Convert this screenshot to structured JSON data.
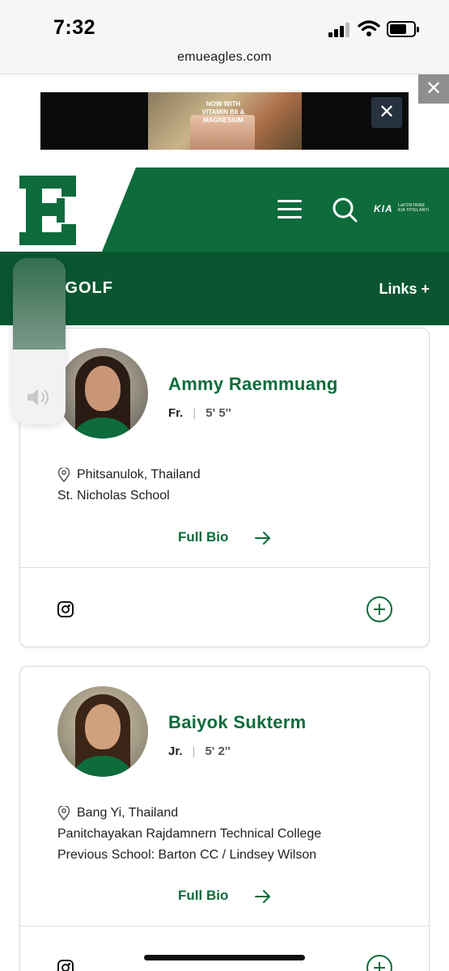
{
  "status_bar": {
    "time": "7:32",
    "signal_icon": "cellular-signal-icon",
    "wifi_icon": "wifi-icon",
    "battery_icon": "battery-icon"
  },
  "browser": {
    "url": "emueagles.com"
  },
  "ad": {
    "close_outer": "✕",
    "close_inner": "✕",
    "image_text": "NOW WITH VITAMIN B6 & MAGNESIUM"
  },
  "header": {
    "logo_icon": "emu-e-logo-icon",
    "menu_icon": "hamburger-menu-icon",
    "search_icon": "search-icon",
    "sponsor": {
      "brand": "KIA",
      "dealer": "LaFONTAINE KIA YPSILANTI"
    },
    "brand_color": "#0e6b3c"
  },
  "subheader": {
    "title": "EN'S GOLF",
    "links_label": "Links +"
  },
  "volume_hud": {
    "level": 0.45,
    "icon": "speaker-icon"
  },
  "players": [
    {
      "name": "Ammy Raemmuang",
      "year": "Fr.",
      "height": "5' 5''",
      "hometown": "Phitsanulok, Thailand",
      "school": "St. Nicholas School",
      "full_bio": "Full Bio"
    },
    {
      "name": "Baiyok Sukterm",
      "year": "Jr.",
      "height": "5' 2''",
      "hometown": "Bang Yi, Thailand",
      "school": "Panitchayakan Rajdamnern Technical College",
      "previous_school": "Previous School: Barton CC / Lindsey Wilson",
      "full_bio": "Full Bio"
    }
  ]
}
